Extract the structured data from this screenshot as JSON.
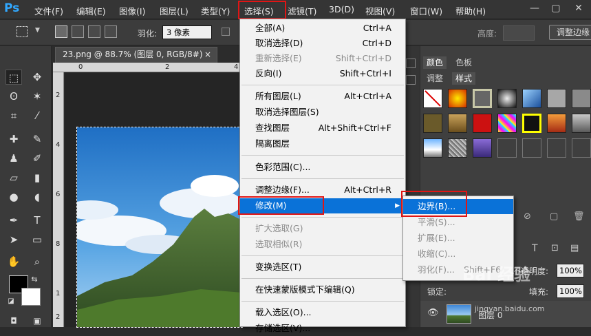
{
  "app": {
    "logo": "Ps"
  },
  "menubar": {
    "items": [
      "文件(F)",
      "编辑(E)",
      "图像(I)",
      "图层(L)",
      "类型(Y)",
      "选择(S)",
      "滤镜(T)",
      "3D(D)",
      "视图(V)",
      "窗口(W)",
      "帮助(H)"
    ],
    "active": "选择(S)",
    "window_controls": [
      "—",
      "▢",
      "✕"
    ]
  },
  "options": {
    "feather_label": "羽化:",
    "feather_value": "3 像素",
    "height_label": "高度:",
    "refine_edge_label": "调整边缘"
  },
  "document": {
    "tab_title": "23.png @ 88.7% (图层 0, RGB/8#)",
    "tab_close": "×",
    "ruler_top_numbers": [
      "0",
      "2",
      "4"
    ],
    "ruler_left_numbers": [
      "2",
      "4",
      "6",
      "8",
      "1",
      "2"
    ]
  },
  "select_menu": {
    "items": [
      {
        "label": "全部(A)",
        "shortcut": "Ctrl+A",
        "enabled": true
      },
      {
        "label": "取消选择(D)",
        "shortcut": "Ctrl+D",
        "enabled": true
      },
      {
        "label": "重新选择(E)",
        "shortcut": "Shift+Ctrl+D",
        "enabled": false
      },
      {
        "label": "反向(I)",
        "shortcut": "Shift+Ctrl+I",
        "enabled": true
      },
      {
        "label": "所有图层(L)",
        "shortcut": "Alt+Ctrl+A",
        "enabled": true
      },
      {
        "label": "取消选择图层(S)",
        "shortcut": "",
        "enabled": true
      },
      {
        "label": "查找图层",
        "shortcut": "Alt+Shift+Ctrl+F",
        "enabled": true
      },
      {
        "label": "隔离图层",
        "shortcut": "",
        "enabled": true
      },
      {
        "label": "色彩范围(C)...",
        "shortcut": "",
        "enabled": true
      },
      {
        "label": "调整边缘(F)...",
        "shortcut": "Alt+Ctrl+R",
        "enabled": true
      },
      {
        "label": "修改(M)",
        "shortcut": "▶",
        "enabled": true,
        "highlighted": true
      },
      {
        "label": "扩大选取(G)",
        "shortcut": "",
        "enabled": false
      },
      {
        "label": "选取相似(R)",
        "shortcut": "",
        "enabled": false
      },
      {
        "label": "变换选区(T)",
        "shortcut": "",
        "enabled": true
      },
      {
        "label": "在快速蒙版模式下编辑(Q)",
        "shortcut": "",
        "enabled": true
      },
      {
        "label": "载入选区(O)...",
        "shortcut": "",
        "enabled": true
      },
      {
        "label": "存储选区(V)...",
        "shortcut": "",
        "enabled": true
      }
    ]
  },
  "modify_submenu": {
    "items": [
      {
        "label": "边界(B)...",
        "shortcut": "",
        "highlighted": true
      },
      {
        "label": "平滑(S)...",
        "shortcut": ""
      },
      {
        "label": "扩展(E)...",
        "shortcut": ""
      },
      {
        "label": "收缩(C)...",
        "shortcut": ""
      },
      {
        "label": "羽化(F)...",
        "shortcut": "Shift+F6"
      }
    ]
  },
  "panels": {
    "tabs_top": [
      "颜色",
      "色板"
    ],
    "tabs_second": [
      "调整",
      "样式"
    ],
    "opacity_label": "不透明度:",
    "opacity_value": "100%",
    "lock_label": "锁定:",
    "fill_label": "填充:",
    "fill_value": "100%",
    "layer_name": "图层 0"
  },
  "watermark": {
    "text": "Bai 经验",
    "url": "jingyan.baidu.com"
  },
  "colors": {
    "accent": "#0a72d8",
    "highlight_box": "#e01515",
    "ps_blue": "#31a8ff"
  }
}
